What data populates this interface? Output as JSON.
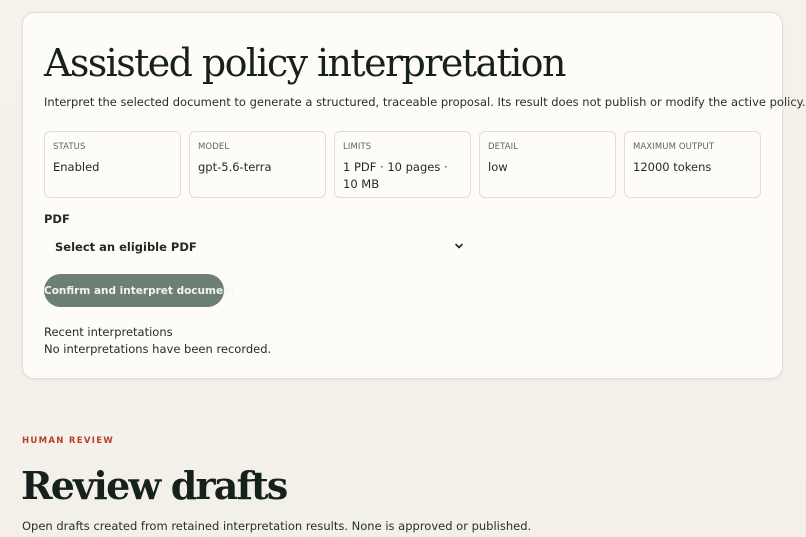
{
  "interpretation": {
    "title": "Assisted policy interpretation",
    "description": "Interpret the selected document to generate a structured, traceable proposal. Its result does not publish or modify the active policy.",
    "stats": [
      {
        "label": "STATUS",
        "value": "Enabled"
      },
      {
        "label": "MODEL",
        "value": "gpt-5.6-terra"
      },
      {
        "label": "LIMITS",
        "value": "1 PDF · 10 pages · 10 MB"
      },
      {
        "label": "DETAIL",
        "value": "low"
      },
      {
        "label": "MAXIMUM OUTPUT",
        "value": "12000 tokens"
      }
    ],
    "pdf_label": "PDF",
    "pdf_select_value": "Select an eligible PDF",
    "confirm_label": "Confirm and interpret document",
    "recent_title": "Recent interpretations",
    "recent_empty": "No interpretations have been recorded."
  },
  "review": {
    "eyebrow": "HUMAN REVIEW",
    "title": "Review drafts",
    "description": "Open drafts created from retained interpretation results. None is approved or published."
  },
  "colors": {
    "accent": "#6b8072",
    "eyebrow": "#b5412b"
  },
  "icons": {
    "select_chevron": "chevron-down-icon"
  }
}
